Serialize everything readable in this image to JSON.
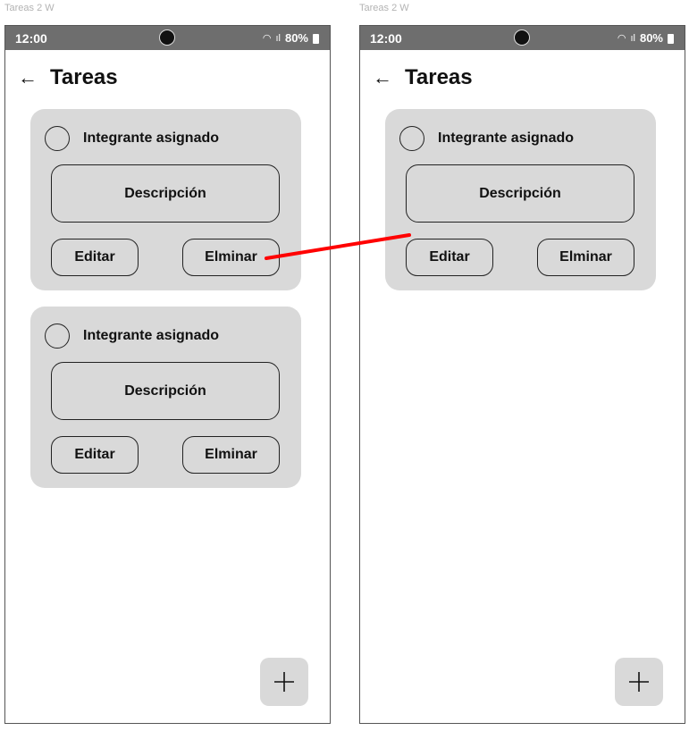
{
  "frames": [
    {
      "label": "Tareas 2 W",
      "status": {
        "time": "12:00",
        "battery": "80%"
      },
      "title": "Tareas",
      "tasks": [
        {
          "assignee": "Integrante asignado",
          "description": "Descripción",
          "edit_label": "Editar",
          "delete_label": "Elminar"
        },
        {
          "assignee": "Integrante asignado",
          "description": "Descripción",
          "edit_label": "Editar",
          "delete_label": "Elminar"
        }
      ]
    },
    {
      "label": "Tareas 2 W",
      "status": {
        "time": "12:00",
        "battery": "80%"
      },
      "title": "Tareas",
      "tasks": [
        {
          "assignee": "Integrante asignado",
          "description": "Descripción",
          "edit_label": "Editar",
          "delete_label": "Elminar"
        }
      ]
    }
  ],
  "icons": {
    "back": "arrow-left-icon",
    "add": "plus-icon",
    "wifi": "wifi-icon",
    "signal": "signal-icon",
    "battery": "battery-icon"
  },
  "colors": {
    "connector": "#ff0000",
    "card": "#d9d9d9",
    "statusbar": "#6e6e6e"
  }
}
